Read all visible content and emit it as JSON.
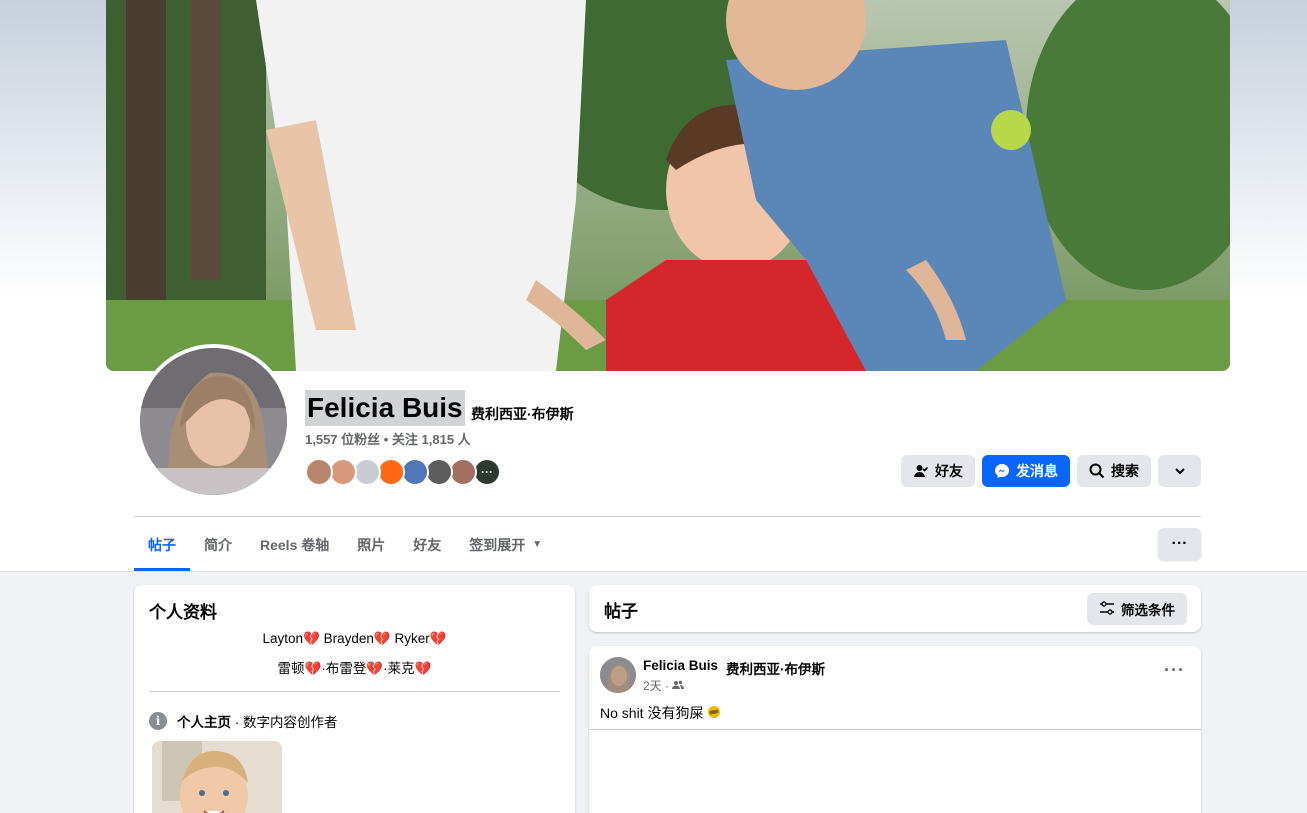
{
  "profile": {
    "name": "Felicia Buis",
    "alt_name": "费利西亚·布伊斯",
    "stats": "1,557 位粉丝 • 关注 1,815 人",
    "friend_more": "···"
  },
  "actions": {
    "friends": "好友",
    "message": "发消息",
    "search": "搜索"
  },
  "tabs": [
    {
      "label": "帖子"
    },
    {
      "label": "简介"
    },
    {
      "label": "Reels 卷轴"
    },
    {
      "label": "照片"
    },
    {
      "label": "好友"
    },
    {
      "label": "签到展开"
    }
  ],
  "tab_more": "···",
  "intro": {
    "title": "个人资料",
    "bio_line1": [
      "Layton",
      "Brayden",
      "Ryker"
    ],
    "bio_line2": [
      "雷顿",
      "·布雷登",
      "·莱克"
    ],
    "heart": "💔",
    "info_label": "个人主页",
    "info_value": " · 数字内容创作者"
  },
  "posts": {
    "title": "帖子",
    "filter": "筛选条件"
  },
  "post": {
    "author": "Felicia Buis",
    "author_alt": "费利西亚·布伊斯",
    "time": "2天 ·",
    "text": "No shit  没有狗屎",
    "more": "···"
  },
  "colors": {
    "accent": "#0866ff",
    "button_bg": "#e4e6eb",
    "secondary_text": "#65676b",
    "page_bg": "#f0f2f5"
  }
}
